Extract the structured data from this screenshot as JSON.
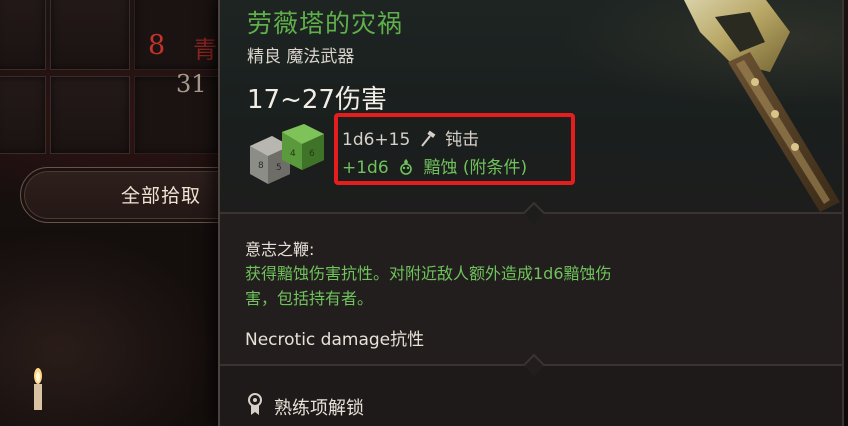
{
  "background": {
    "count_red": "8",
    "count_red_2": "青",
    "count_grey": "31",
    "pickup_all_label": "全部拾取"
  },
  "tooltip": {
    "item_name": "劳薇塔的灾祸",
    "subtitle": "精良 魔法武器",
    "damage_range": "17~27伤害",
    "damage_lines": [
      {
        "dice": "1d6+15",
        "icon": "hammer-icon",
        "type": "钝击"
      },
      {
        "dice": "+1d6",
        "icon": "necrotic-skull-icon",
        "type": "黯蚀 (附条件)"
      }
    ],
    "passive": {
      "title": "意志之鞭:",
      "desc_line1": "获得黯蚀伤害抗性。对附近敌人额外造成1d6黯蚀伤",
      "desc_line2": "害，包括持有者。"
    },
    "resist_line": "Necrotic damage抗性",
    "proficiency_label": "熟练项解锁"
  },
  "colors": {
    "item_name": "#5fb04a",
    "highlight_box": "#e51d1d",
    "green_text": "#6fc25c"
  }
}
